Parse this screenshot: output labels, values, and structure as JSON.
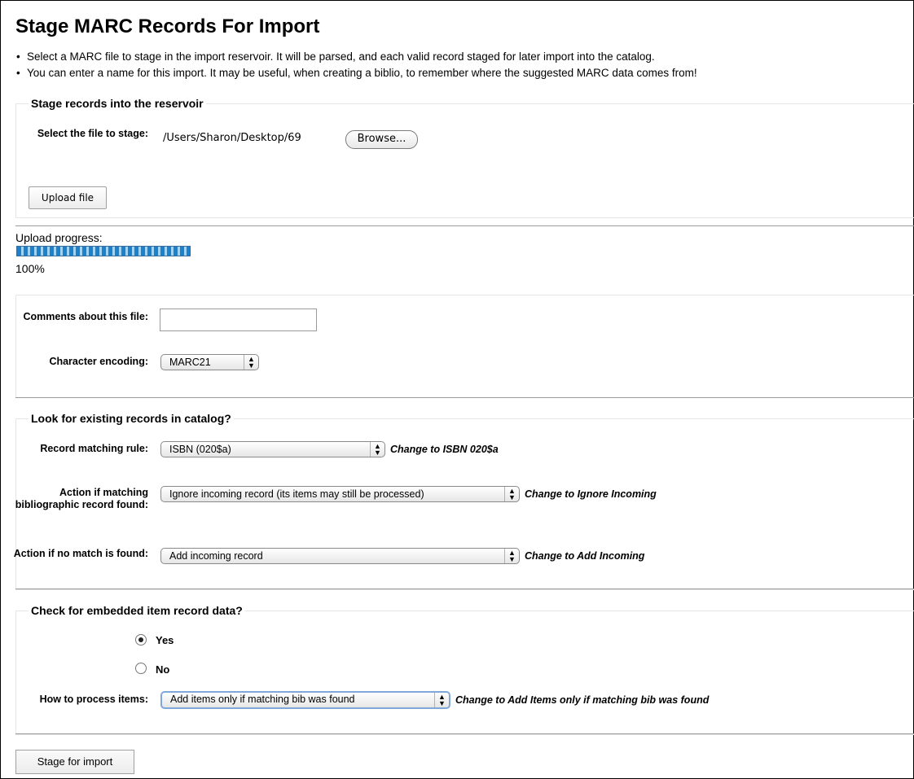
{
  "page_title": "Stage MARC Records For Import",
  "intro": [
    "Select a MARC file to stage in the import reservoir. It will be parsed, and each valid record staged for later import into the catalog.",
    "You can enter a name for this import. It may be useful, when creating a biblio, to remember where the suggested MARC data comes from!"
  ],
  "stage_section": {
    "legend": "Stage records into the reservoir",
    "file_label": "Select the file to stage:",
    "file_path": "/Users/Sharon/Desktop/69",
    "browse_label": "Browse...",
    "upload_label": "Upload file"
  },
  "upload_progress": {
    "label": "Upload progress:",
    "value_percent": 100,
    "percent_text": "100%"
  },
  "file_section": {
    "comments_label": "Comments about this file:",
    "comments_value": "",
    "encoding_label": "Character encoding:",
    "encoding_value": "MARC21"
  },
  "match_section": {
    "legend": "Look for existing records in catalog?",
    "rule_label": "Record matching rule:",
    "rule_value": "ISBN (020$a)",
    "rule_note": "Change to ISBN 020$a",
    "match_action_label": "Action if matching bibliographic record found:",
    "match_action_value": "Ignore incoming record (its items may still be processed)",
    "match_action_note": "Change to Ignore Incoming",
    "nomatch_label": "Action if no match is found:",
    "nomatch_value": "Add incoming record",
    "nomatch_note": "Change to Add Incoming"
  },
  "item_section": {
    "legend": "Check for embedded item record data?",
    "yes_label": "Yes",
    "no_label": "No",
    "selected": "Yes",
    "process_label": "How to process items:",
    "process_value": "Add items only if matching bib was found",
    "process_note": "Change to Add Items only if matching bib was found"
  },
  "submit_label": "Stage for import",
  "icons": {
    "select_arrows": "updown-arrows-icon",
    "radio": "radio-button-icon"
  },
  "colors": {
    "progress_fill": "#1f7fc9",
    "progress_stripe": "#9ed4f4"
  }
}
